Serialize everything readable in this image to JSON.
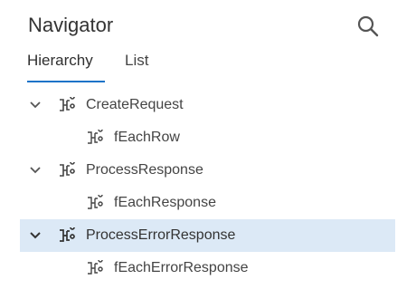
{
  "navigator": {
    "title": "Navigator",
    "search_icon": "search-icon"
  },
  "tabs": [
    {
      "label": "Hierarchy",
      "active": true
    },
    {
      "label": "List",
      "active": false
    }
  ],
  "tree": [
    {
      "label": "CreateRequest",
      "expanded": true,
      "level": 0,
      "selected": false,
      "icon": "flow-icon"
    },
    {
      "label": "fEachRow",
      "level": 1,
      "selected": false,
      "icon": "flow-icon"
    },
    {
      "label": "ProcessResponse",
      "expanded": true,
      "level": 0,
      "selected": false,
      "icon": "flow-icon"
    },
    {
      "label": "fEachResponse",
      "level": 1,
      "selected": false,
      "icon": "flow-icon"
    },
    {
      "label": "ProcessErrorResponse",
      "expanded": true,
      "level": 0,
      "selected": true,
      "icon": "flow-icon"
    },
    {
      "label": "fEachErrorResponse",
      "level": 1,
      "selected": false,
      "icon": "flow-icon"
    }
  ],
  "colors": {
    "accent": "#1e73c8",
    "selected_row": "#dce9f6",
    "text": "#444444"
  }
}
